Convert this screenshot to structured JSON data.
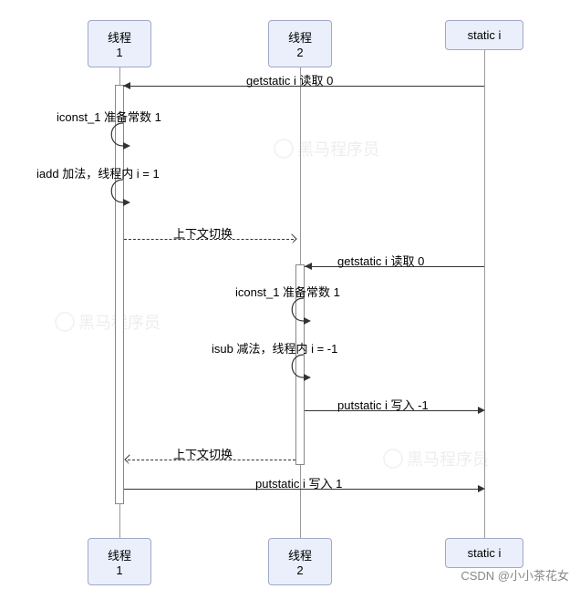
{
  "participants": {
    "p1": "线程1",
    "p2": "线程2",
    "p3": "static i"
  },
  "messages": {
    "m1": "getstatic i 读取 0",
    "m2": "iconst_1 准备常数 1",
    "m3": "iadd 加法，线程内 i = 1",
    "m4": "上下文切换",
    "m5": "getstatic i 读取 0",
    "m6": "iconst_1 准备常数 1",
    "m7": "isub 减法，线程内 i = -1",
    "m8": "putstatic i 写入 -1",
    "m9": "上下文切换",
    "m10": "putstatic i 写入 1"
  },
  "watermark": "黑马程序员",
  "credit": "CSDN @小小茶花女",
  "chart_data": {
    "type": "sequence-diagram",
    "participants": [
      "线程1",
      "线程2",
      "static i"
    ],
    "events": [
      {
        "from": "static i",
        "to": "线程1",
        "label": "getstatic i 读取 0",
        "style": "solid"
      },
      {
        "from": "线程1",
        "to": "线程1",
        "label": "iconst_1 准备常数 1",
        "style": "self"
      },
      {
        "from": "线程1",
        "to": "线程1",
        "label": "iadd 加法，线程内 i = 1",
        "style": "self"
      },
      {
        "from": "线程1",
        "to": "线程2",
        "label": "上下文切换",
        "style": "dashed"
      },
      {
        "from": "static i",
        "to": "线程2",
        "label": "getstatic i 读取 0",
        "style": "solid"
      },
      {
        "from": "线程2",
        "to": "线程2",
        "label": "iconst_1 准备常数 1",
        "style": "self"
      },
      {
        "from": "线程2",
        "to": "线程2",
        "label": "isub 减法，线程内 i = -1",
        "style": "self"
      },
      {
        "from": "线程2",
        "to": "static i",
        "label": "putstatic i 写入 -1",
        "style": "solid"
      },
      {
        "from": "线程2",
        "to": "线程1",
        "label": "上下文切换",
        "style": "dashed"
      },
      {
        "from": "线程1",
        "to": "static i",
        "label": "putstatic i 写入 1",
        "style": "solid"
      }
    ]
  }
}
